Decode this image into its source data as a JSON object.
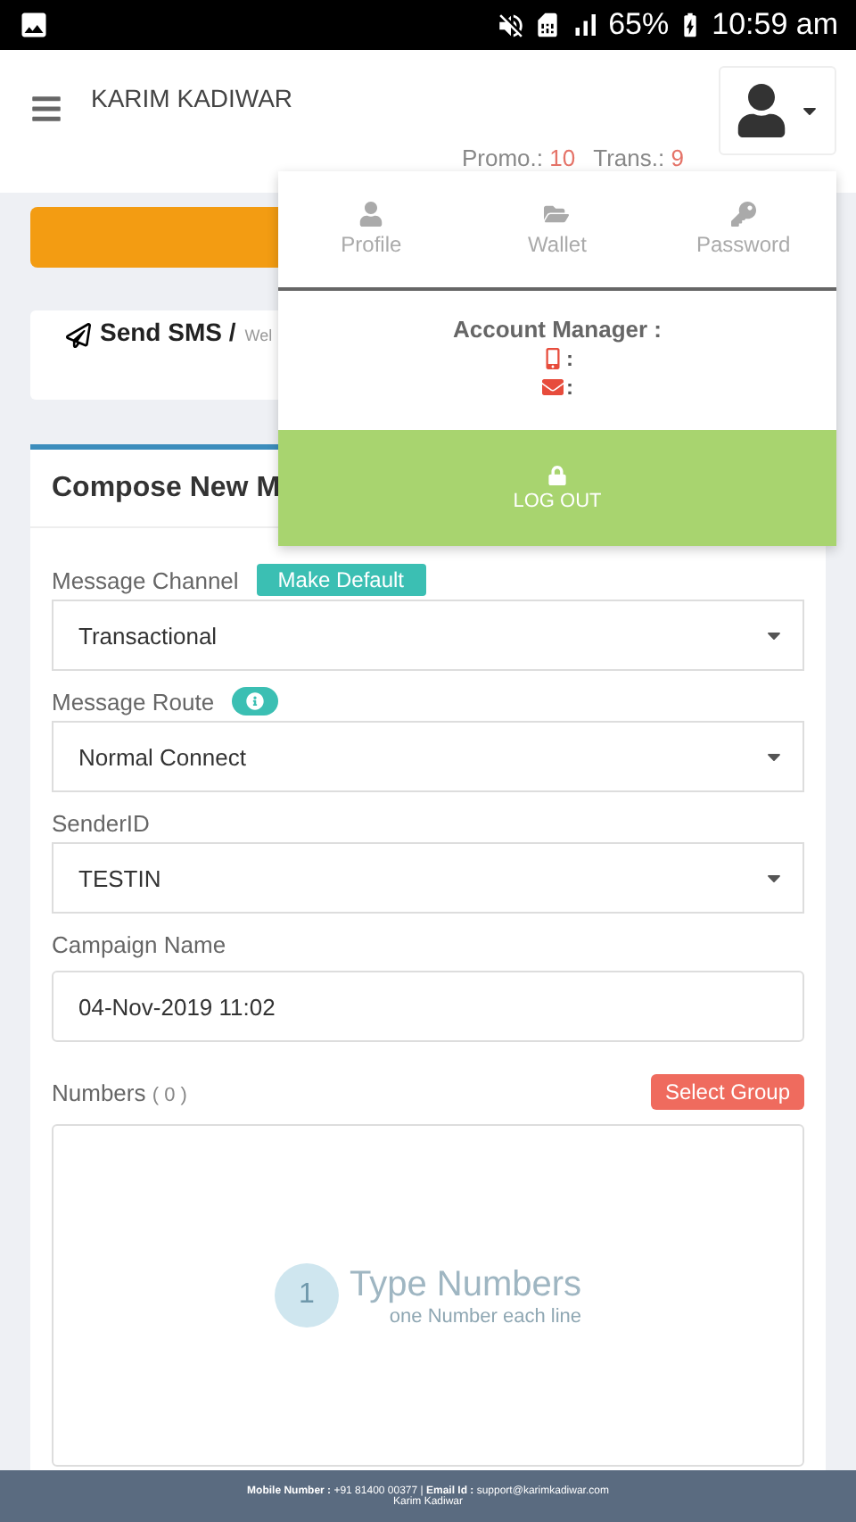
{
  "status_bar": {
    "battery": "65%",
    "time": "10:59 am"
  },
  "header": {
    "user_name": "KARIM KADIWAR",
    "credits": [
      {
        "label": "Promo.:",
        "value": "10"
      },
      {
        "label": "Trans.:",
        "value": "9"
      }
    ]
  },
  "account_menu": {
    "tabs": [
      {
        "kind": "profile",
        "label": "Profile"
      },
      {
        "kind": "wallet",
        "label": "Wallet"
      },
      {
        "kind": "password",
        "label": "Password"
      }
    ],
    "manager_title": "Account Manager :",
    "contacts": [
      {
        "kind": "phone",
        "value": ":"
      },
      {
        "kind": "email",
        "value": ":"
      }
    ],
    "logout": "LOG OUT"
  },
  "breadcrumb": {
    "title": "Send SMS /",
    "subtitle": "Wel"
  },
  "compose": {
    "title": "Compose New M",
    "fields": [
      {
        "kind": "select",
        "label": "Message Channel",
        "badge": {
          "kind": "button",
          "text": "Make Default"
        },
        "value": "Transactional"
      },
      {
        "kind": "select",
        "label": "Message Route",
        "badge": {
          "kind": "info"
        },
        "value": "Normal Connect"
      },
      {
        "kind": "select",
        "label": "SenderID",
        "value": "TESTIN"
      },
      {
        "kind": "text",
        "label": "Campaign Name",
        "value": "04-Nov-2019 11:02"
      }
    ],
    "numbers": {
      "label": "Numbers",
      "count": "( 0 )",
      "button": "Select Group",
      "step": "1",
      "hint_title": "Type Numbers",
      "hint_text": "one Number each line"
    }
  },
  "footer": {
    "contact": "**Mobile Number :** +91 81400 00377 | **Email Id :** support@karimkadiwar.com",
    "company": "Karim Kadiwar"
  }
}
